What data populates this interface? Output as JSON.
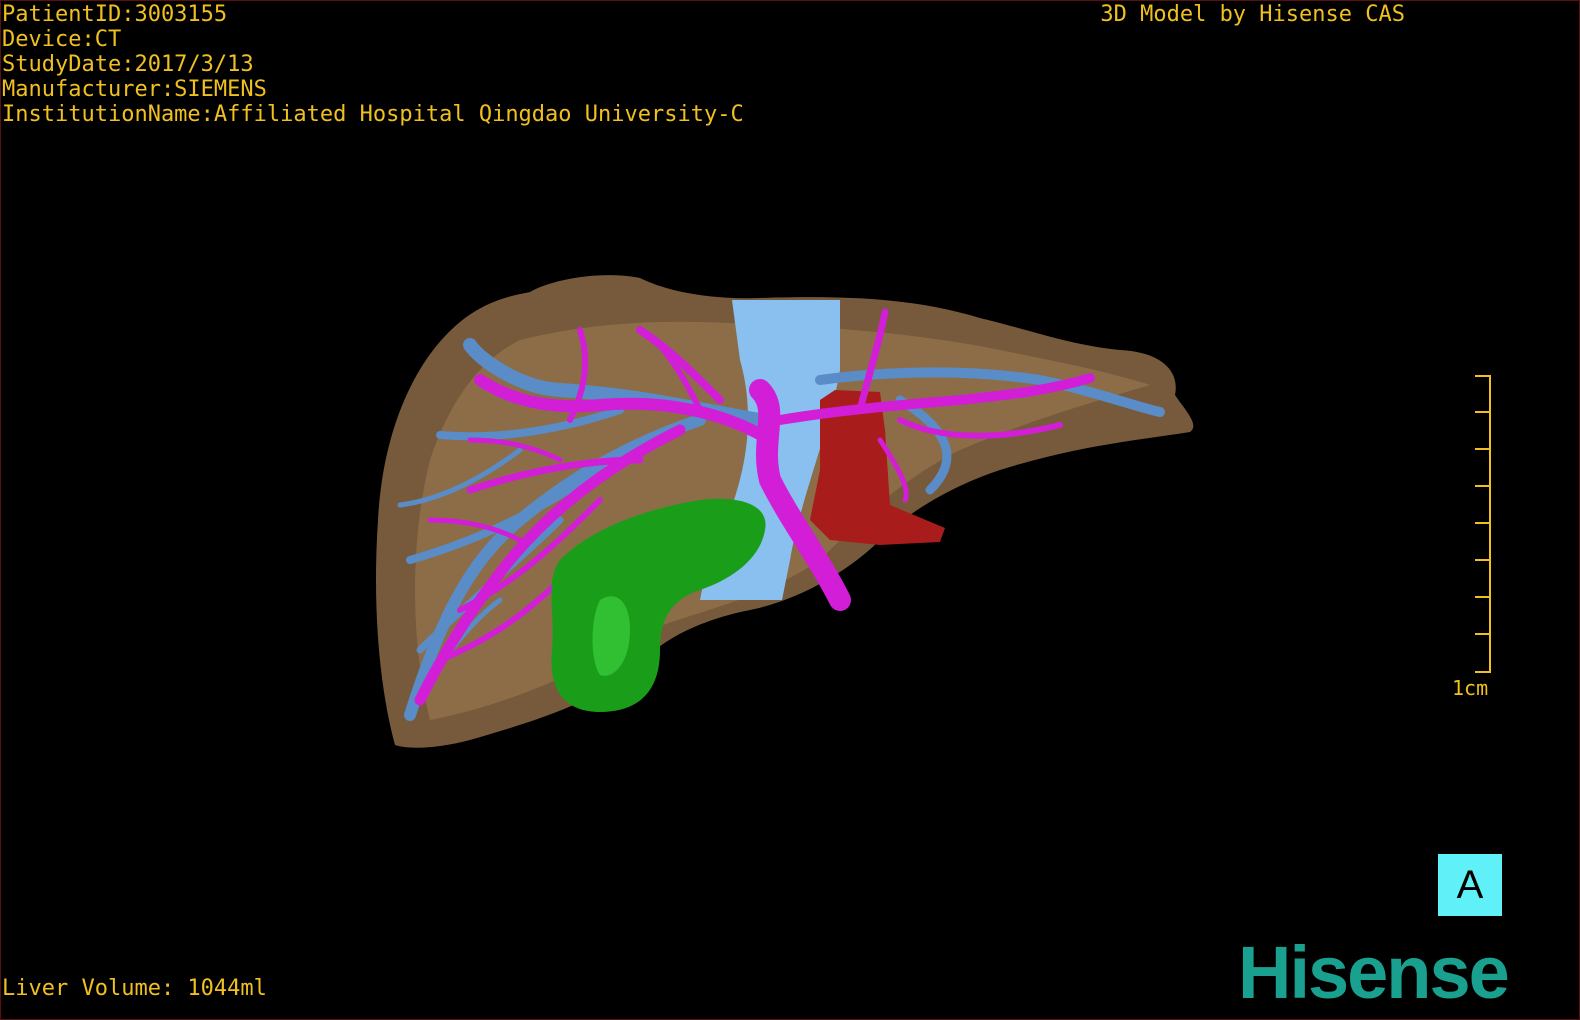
{
  "patient": {
    "id_line": "PatientID:3003155",
    "device_line": "Device:CT",
    "date_line": "StudyDate:2017/3/13",
    "manufacturer_line": "Manufacturer:SIEMENS",
    "institution_line": "InstitutionName:Affiliated Hospital Qingdao University-C"
  },
  "credit": "3D Model by Hisense CAS",
  "volume": "Liver Volume: 1044ml",
  "scale_label": "1cm",
  "orientation_label": "A",
  "logo_text": "Hisense",
  "colors": {
    "text": "#f0c020",
    "liver": "#8a6a45",
    "portal_vein": "#d020d8",
    "hepatic_vein": "#5a8cc8",
    "ivc": "#8ac0f0",
    "gallbladder": "#1fa01f",
    "aorta": "#b02020",
    "orientation_bg": "#5ff0f8",
    "logo": "#1aa08f"
  },
  "icons": {
    "orientation": "orientation-cube-icon",
    "scale": "scale-bar-icon"
  }
}
